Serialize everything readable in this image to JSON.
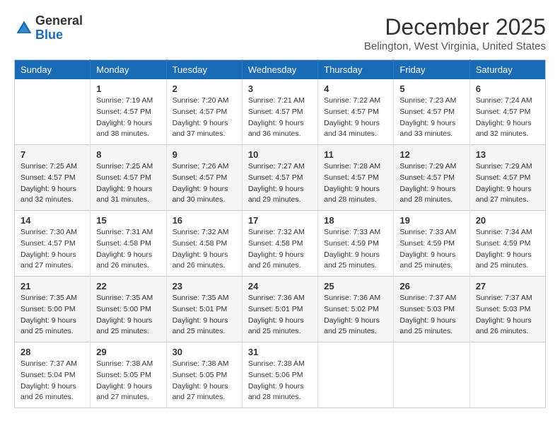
{
  "logo": {
    "general": "General",
    "blue": "Blue"
  },
  "title": "December 2025",
  "location": "Belington, West Virginia, United States",
  "days_of_week": [
    "Sunday",
    "Monday",
    "Tuesday",
    "Wednesday",
    "Thursday",
    "Friday",
    "Saturday"
  ],
  "weeks": [
    [
      {
        "day": "",
        "info": ""
      },
      {
        "day": "1",
        "info": "Sunrise: 7:19 AM\nSunset: 4:57 PM\nDaylight: 9 hours\nand 38 minutes."
      },
      {
        "day": "2",
        "info": "Sunrise: 7:20 AM\nSunset: 4:57 PM\nDaylight: 9 hours\nand 37 minutes."
      },
      {
        "day": "3",
        "info": "Sunrise: 7:21 AM\nSunset: 4:57 PM\nDaylight: 9 hours\nand 36 minutes."
      },
      {
        "day": "4",
        "info": "Sunrise: 7:22 AM\nSunset: 4:57 PM\nDaylight: 9 hours\nand 34 minutes."
      },
      {
        "day": "5",
        "info": "Sunrise: 7:23 AM\nSunset: 4:57 PM\nDaylight: 9 hours\nand 33 minutes."
      },
      {
        "day": "6",
        "info": "Sunrise: 7:24 AM\nSunset: 4:57 PM\nDaylight: 9 hours\nand 32 minutes."
      }
    ],
    [
      {
        "day": "7",
        "info": "Sunrise: 7:25 AM\nSunset: 4:57 PM\nDaylight: 9 hours\nand 32 minutes."
      },
      {
        "day": "8",
        "info": "Sunrise: 7:25 AM\nSunset: 4:57 PM\nDaylight: 9 hours\nand 31 minutes."
      },
      {
        "day": "9",
        "info": "Sunrise: 7:26 AM\nSunset: 4:57 PM\nDaylight: 9 hours\nand 30 minutes."
      },
      {
        "day": "10",
        "info": "Sunrise: 7:27 AM\nSunset: 4:57 PM\nDaylight: 9 hours\nand 29 minutes."
      },
      {
        "day": "11",
        "info": "Sunrise: 7:28 AM\nSunset: 4:57 PM\nDaylight: 9 hours\nand 28 minutes."
      },
      {
        "day": "12",
        "info": "Sunrise: 7:29 AM\nSunset: 4:57 PM\nDaylight: 9 hours\nand 28 minutes."
      },
      {
        "day": "13",
        "info": "Sunrise: 7:29 AM\nSunset: 4:57 PM\nDaylight: 9 hours\nand 27 minutes."
      }
    ],
    [
      {
        "day": "14",
        "info": "Sunrise: 7:30 AM\nSunset: 4:57 PM\nDaylight: 9 hours\nand 27 minutes."
      },
      {
        "day": "15",
        "info": "Sunrise: 7:31 AM\nSunset: 4:58 PM\nDaylight: 9 hours\nand 26 minutes."
      },
      {
        "day": "16",
        "info": "Sunrise: 7:32 AM\nSunset: 4:58 PM\nDaylight: 9 hours\nand 26 minutes."
      },
      {
        "day": "17",
        "info": "Sunrise: 7:32 AM\nSunset: 4:58 PM\nDaylight: 9 hours\nand 26 minutes."
      },
      {
        "day": "18",
        "info": "Sunrise: 7:33 AM\nSunset: 4:59 PM\nDaylight: 9 hours\nand 25 minutes."
      },
      {
        "day": "19",
        "info": "Sunrise: 7:33 AM\nSunset: 4:59 PM\nDaylight: 9 hours\nand 25 minutes."
      },
      {
        "day": "20",
        "info": "Sunrise: 7:34 AM\nSunset: 4:59 PM\nDaylight: 9 hours\nand 25 minutes."
      }
    ],
    [
      {
        "day": "21",
        "info": "Sunrise: 7:35 AM\nSunset: 5:00 PM\nDaylight: 9 hours\nand 25 minutes."
      },
      {
        "day": "22",
        "info": "Sunrise: 7:35 AM\nSunset: 5:00 PM\nDaylight: 9 hours\nand 25 minutes."
      },
      {
        "day": "23",
        "info": "Sunrise: 7:35 AM\nSunset: 5:01 PM\nDaylight: 9 hours\nand 25 minutes."
      },
      {
        "day": "24",
        "info": "Sunrise: 7:36 AM\nSunset: 5:01 PM\nDaylight: 9 hours\nand 25 minutes."
      },
      {
        "day": "25",
        "info": "Sunrise: 7:36 AM\nSunset: 5:02 PM\nDaylight: 9 hours\nand 25 minutes."
      },
      {
        "day": "26",
        "info": "Sunrise: 7:37 AM\nSunset: 5:03 PM\nDaylight: 9 hours\nand 25 minutes."
      },
      {
        "day": "27",
        "info": "Sunrise: 7:37 AM\nSunset: 5:03 PM\nDaylight: 9 hours\nand 26 minutes."
      }
    ],
    [
      {
        "day": "28",
        "info": "Sunrise: 7:37 AM\nSunset: 5:04 PM\nDaylight: 9 hours\nand 26 minutes."
      },
      {
        "day": "29",
        "info": "Sunrise: 7:38 AM\nSunset: 5:05 PM\nDaylight: 9 hours\nand 27 minutes."
      },
      {
        "day": "30",
        "info": "Sunrise: 7:38 AM\nSunset: 5:05 PM\nDaylight: 9 hours\nand 27 minutes."
      },
      {
        "day": "31",
        "info": "Sunrise: 7:38 AM\nSunset: 5:06 PM\nDaylight: 9 hours\nand 28 minutes."
      },
      {
        "day": "",
        "info": ""
      },
      {
        "day": "",
        "info": ""
      },
      {
        "day": "",
        "info": ""
      }
    ]
  ]
}
